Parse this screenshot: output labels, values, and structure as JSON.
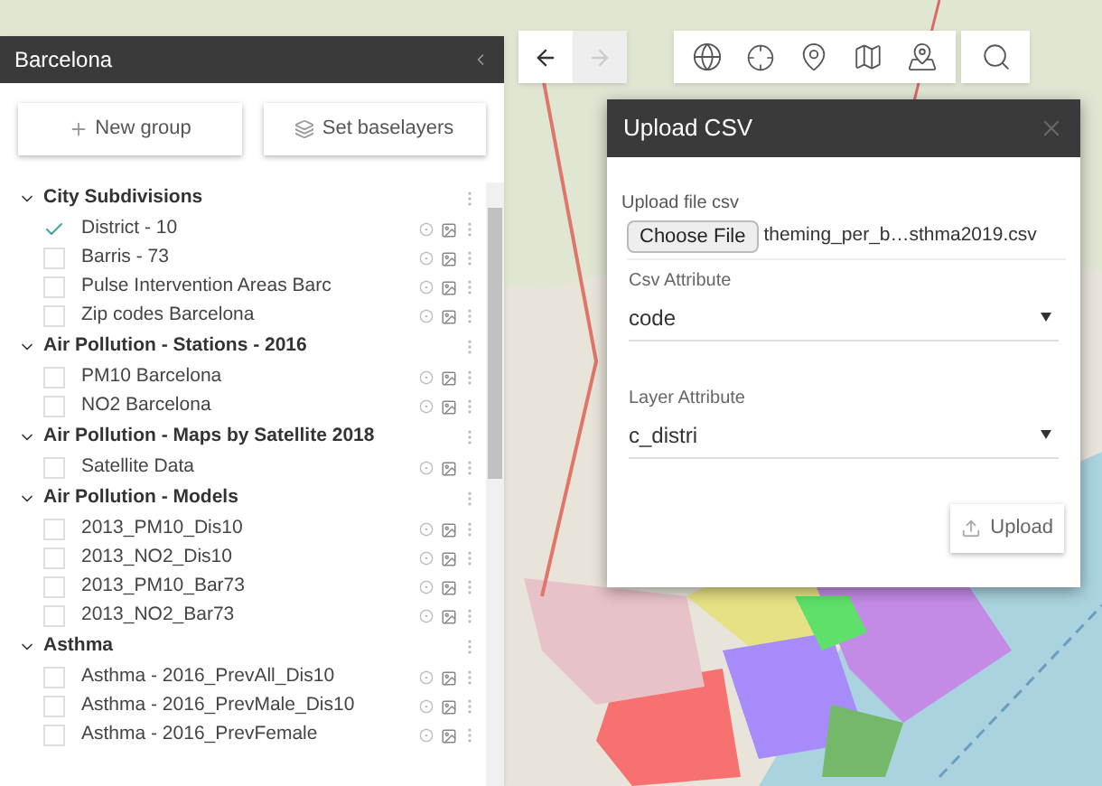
{
  "sidebar": {
    "title": "Barcelona",
    "buttons": [
      {
        "kind": "add",
        "label": "New group"
      },
      {
        "kind": "layers",
        "label": "Set baselayers"
      }
    ],
    "groups": [
      {
        "title": "City Subdivisions",
        "expanded": true,
        "children": [
          {
            "label": "District - 10",
            "checked": true
          },
          {
            "label": "Barris - 73",
            "checked": false
          },
          {
            "label": "Pulse Intervention Areas Barc",
            "checked": false
          },
          {
            "label": "Zip codes Barcelona",
            "checked": false
          }
        ]
      },
      {
        "title": "Air Pollution - Stations - 2016",
        "expanded": true,
        "children": [
          {
            "label": "PM10 Barcelona",
            "checked": false
          },
          {
            "label": "NO2 Barcelona",
            "checked": false
          }
        ]
      },
      {
        "title": "Air Pollution - Maps by Satellite 2018",
        "expanded": true,
        "children": [
          {
            "label": "Satellite Data",
            "checked": false
          }
        ]
      },
      {
        "title": "Air Pollution - Models",
        "expanded": true,
        "children": [
          {
            "label": "2013_PM10_Dis10",
            "checked": false
          },
          {
            "label": "2013_NO2_Dis10",
            "checked": false
          },
          {
            "label": "2013_PM10_Bar73",
            "checked": false
          },
          {
            "label": "2013_NO2_Bar73",
            "checked": false
          }
        ]
      },
      {
        "title": "Asthma",
        "expanded": true,
        "children": [
          {
            "label": "Asthma - 2016_PrevAll_Dis10",
            "checked": false
          },
          {
            "label": "Asthma - 2016_PrevMale_Dis10",
            "checked": false
          },
          {
            "label": "Asthma - 2016_PrevFemale",
            "checked": false
          }
        ]
      }
    ]
  },
  "toolbar": {
    "back": {
      "disabled": false
    },
    "forward": {
      "disabled": true
    }
  },
  "dialog": {
    "title": "Upload CSV",
    "file_label": "Upload file csv",
    "file_button": "Choose File",
    "file_name": "theming_per_b…sthma2019.csv",
    "selects": [
      {
        "label": "Csv Attribute",
        "value": "code"
      },
      {
        "label": "Layer Attribute",
        "value": "c_distri"
      }
    ],
    "upload_button": "Upload"
  }
}
